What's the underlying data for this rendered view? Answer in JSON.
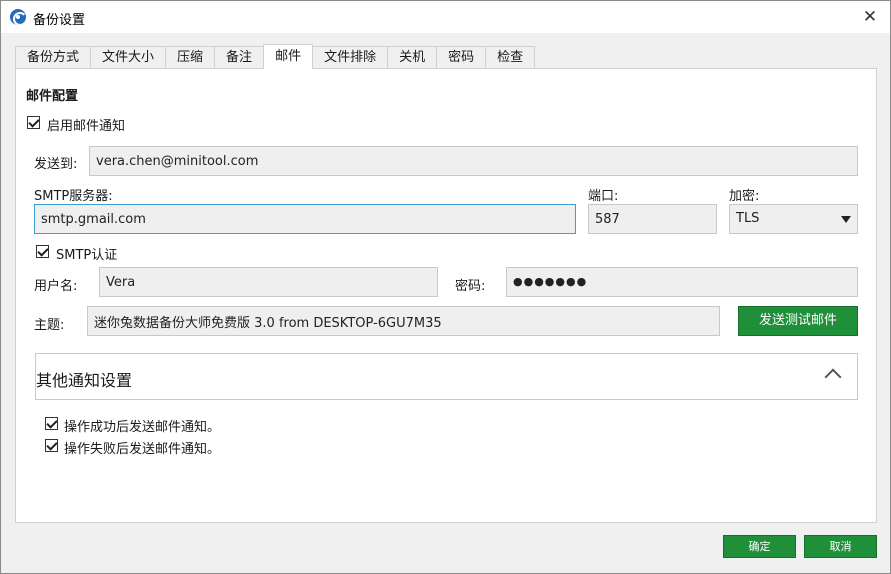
{
  "window": {
    "title": "备份设置",
    "close_glyph": "✕"
  },
  "tabs": [
    {
      "label": "备份方式",
      "active": false
    },
    {
      "label": "文件大小",
      "active": false
    },
    {
      "label": "压缩",
      "active": false
    },
    {
      "label": "备注",
      "active": false
    },
    {
      "label": "邮件",
      "active": true
    },
    {
      "label": "文件排除",
      "active": false
    },
    {
      "label": "关机",
      "active": false
    },
    {
      "label": "密码",
      "active": false
    },
    {
      "label": "检查",
      "active": false
    }
  ],
  "mail": {
    "section_title": "邮件配置",
    "enable_label": "启用邮件通知",
    "enable_checked": true,
    "send_to_label": "发送到:",
    "send_to_value": "vera.chen@minitool.com",
    "smtp_server_label": "SMTP服务器:",
    "smtp_server_value": "smtp.gmail.com",
    "port_label": "端口:",
    "port_value": "587",
    "encryption_label": "加密:",
    "encryption_value": "TLS",
    "smtp_auth_label": "SMTP认证",
    "smtp_auth_checked": true,
    "username_label": "用户名:",
    "username_value": "Vera",
    "password_label": "密码:",
    "password_value": "●●●●●●●",
    "subject_label": "主题:",
    "subject_value": "迷你兔数据备份大师免费版 3.0 from DESKTOP-6GU7M35",
    "send_test_label": "发送测试邮件"
  },
  "other": {
    "title": "其他通知设置",
    "on_success_label": "操作成功后发送邮件通知。",
    "on_success_checked": true,
    "on_failure_label": "操作失败后发送邮件通知。",
    "on_failure_checked": true
  },
  "footer": {
    "ok_label": "确定",
    "cancel_label": "取消"
  },
  "colors": {
    "accent_green": "#1f8f3a",
    "focus_blue": "#3c9fd4"
  }
}
